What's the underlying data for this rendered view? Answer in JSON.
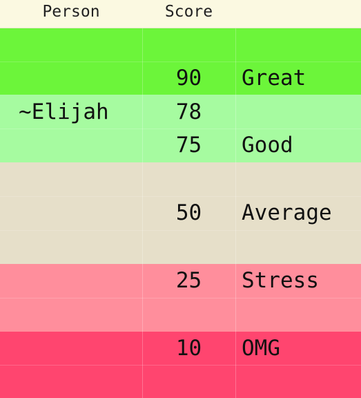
{
  "header": {
    "person": "Person",
    "score": "Score",
    "label": ""
  },
  "colors": {
    "header_bg": "#fbf9e1",
    "great": "#6cf53a",
    "good": "#a6fba0",
    "average": "#e6dfc9",
    "stress": "#ff8e9c",
    "omg": "#ff456f"
  },
  "rows": [
    {
      "band": "great",
      "person": "",
      "score": "",
      "label": ""
    },
    {
      "band": "great",
      "person": "",
      "score": "90",
      "label": "Great"
    },
    {
      "band": "good",
      "person": "~Elijah",
      "score": "78",
      "label": ""
    },
    {
      "band": "good",
      "person": "",
      "score": "75",
      "label": "Good"
    },
    {
      "band": "average",
      "person": "",
      "score": "",
      "label": ""
    },
    {
      "band": "average",
      "person": "",
      "score": "50",
      "label": "Average"
    },
    {
      "band": "average",
      "person": "",
      "score": "",
      "label": ""
    },
    {
      "band": "stress",
      "person": "",
      "score": "25",
      "label": "Stress"
    },
    {
      "band": "stress",
      "person": "",
      "score": "",
      "label": ""
    },
    {
      "band": "omg",
      "person": "",
      "score": "10",
      "label": "OMG"
    },
    {
      "band": "omg",
      "person": "",
      "score": "",
      "label": ""
    }
  ]
}
